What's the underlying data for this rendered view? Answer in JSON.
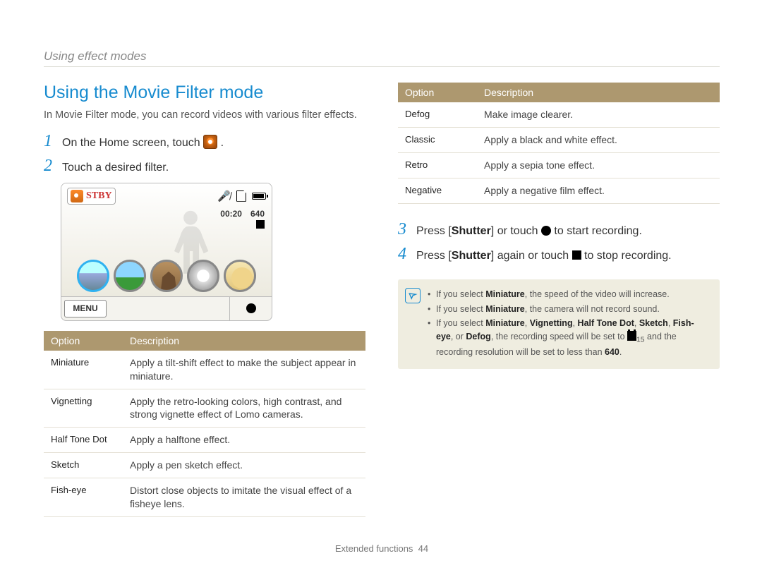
{
  "breadcrumb": "Using effect modes",
  "heading": "Using the Movie Filter mode",
  "intro": "In Movie Filter mode, you can record videos with various filter effects.",
  "steps_left": {
    "1_pre": "On the Home screen, touch ",
    "1_post": ".",
    "2": "Touch a desired filter."
  },
  "lcd": {
    "stby": "STBY",
    "time": "00:20",
    "res": "640",
    "menu": "MENU"
  },
  "table_left": {
    "headers": {
      "option": "Option",
      "desc": "Description"
    },
    "rows": [
      {
        "option": "Miniature",
        "desc": "Apply a tilt-shift effect to make the subject appear in miniature."
      },
      {
        "option": "Vignetting",
        "desc": "Apply the retro-looking colors, high contrast, and strong vignette effect of Lomo cameras."
      },
      {
        "option": "Half Tone Dot",
        "desc": "Apply a halftone effect."
      },
      {
        "option": "Sketch",
        "desc": "Apply a pen sketch effect."
      },
      {
        "option": "Fish-eye",
        "desc": "Distort close objects to imitate the visual effect of a fisheye lens."
      }
    ]
  },
  "table_right": {
    "headers": {
      "option": "Option",
      "desc": "Description"
    },
    "rows": [
      {
        "option": "Defog",
        "desc": "Make image clearer."
      },
      {
        "option": "Classic",
        "desc": "Apply a black and white effect."
      },
      {
        "option": "Retro",
        "desc": "Apply a sepia tone effect."
      },
      {
        "option": "Negative",
        "desc": "Apply a negative film effect."
      }
    ]
  },
  "steps_right": {
    "3_pre": "Press [",
    "3_word": "Shutter",
    "3_mid": "] or touch ",
    "3_post": " to start recording.",
    "4_pre": "Press [",
    "4_word": "Shutter",
    "4_mid": "] again or touch ",
    "4_post": " to stop recording."
  },
  "note": {
    "l1_pre": "If you select ",
    "l1_b": "Miniature",
    "l1_post": ", the speed of the video will increase.",
    "l2_pre": "If you select ",
    "l2_b": "Miniature",
    "l2_post": ", the camera will not record sound.",
    "l3_pre": "If you select ",
    "l3_b1": "Miniature",
    "l3_s1": ", ",
    "l3_b2": "Vignetting",
    "l3_s2": ", ",
    "l3_b3": "Half Tone Dot",
    "l3_s3": ", ",
    "l3_b4": "Sketch",
    "l3_s4": ", ",
    "l3_b5": "Fish-eye",
    "l3_s5": ", or ",
    "l3_b6": "Defog",
    "l3_mid": ", the recording speed will be set to ",
    "l3_sub": "15",
    "l3_post1": " and the recording resolution will be set to less than ",
    "l3_b7": "640",
    "l3_post2": "."
  },
  "footer": {
    "section": "Extended functions",
    "page": "44"
  }
}
